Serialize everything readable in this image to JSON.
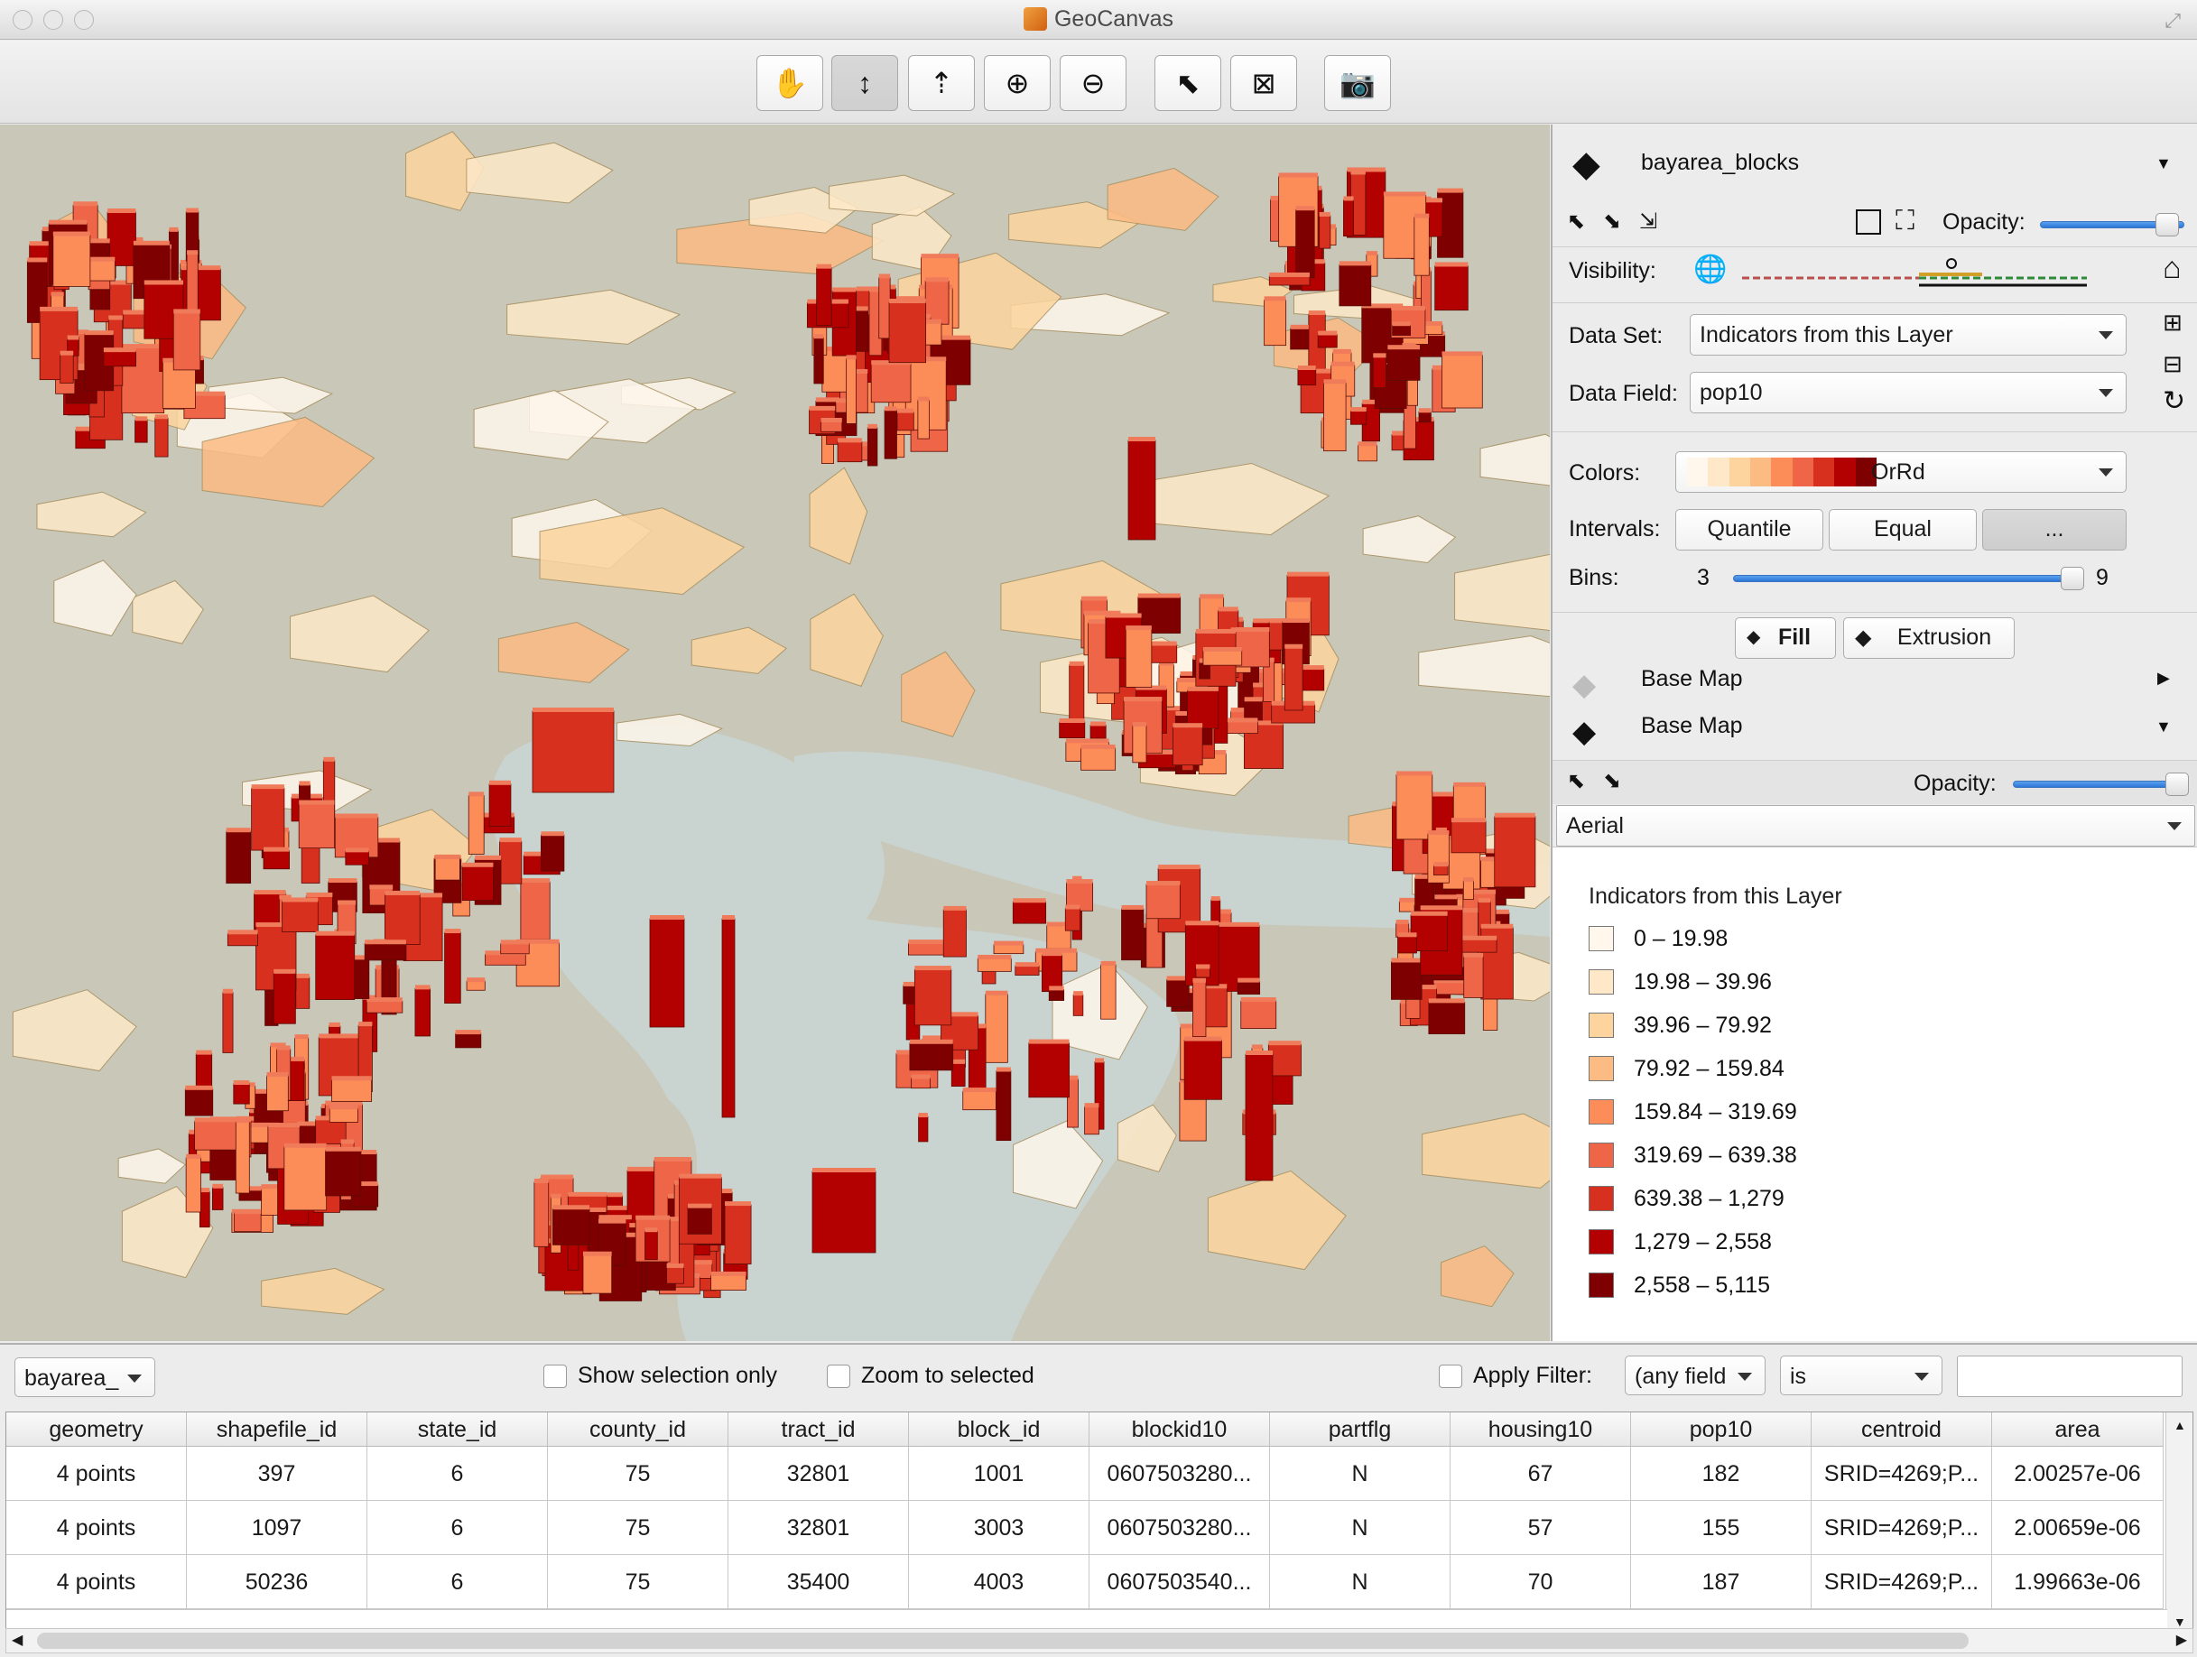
{
  "window": {
    "title": "GeoCanvas"
  },
  "toolbar": {
    "buttons": [
      {
        "icon": "hand-pan-icon",
        "glyph": "✋"
      },
      {
        "icon": "vertical-tilt-icon",
        "glyph": "↕"
      },
      {
        "icon": "rotate-view-icon",
        "glyph": "⇡"
      },
      {
        "icon": "zoom-in-icon",
        "glyph": "⊕"
      },
      {
        "icon": "zoom-out-icon",
        "glyph": "⊖"
      },
      {
        "icon": "select-arrow-icon",
        "glyph": "⬉"
      },
      {
        "icon": "clear-selection-icon",
        "glyph": "⊠"
      },
      {
        "icon": "camera-icon",
        "glyph": "📷"
      }
    ],
    "active_button": "vertical-tilt-icon"
  },
  "panel": {
    "layer_name": "bayarea_blocks",
    "opacity_label": "Opacity:",
    "visibility_label": "Visibility:",
    "dataset_label": "Data Set:",
    "dataset_value": "Indicators from this Layer",
    "datafield_label": "Data Field:",
    "datafield_value": "pop10",
    "colors_label": "Colors:",
    "colors_value": "OrRd",
    "intervals_label": "Intervals:",
    "interval_buttons": [
      "Quantile",
      "Equal",
      "..."
    ],
    "bins_label": "Bins:",
    "bins_min": "3",
    "bins_max": "9",
    "tabs": [
      "Fill",
      "Extrusion"
    ],
    "base_map_1": "Base Map",
    "base_map_2": "Base Map",
    "base_opacity_label": "Opacity:",
    "basemap_select": "Aerial",
    "layer_opacity": 0.88,
    "base_opacity": 0.96,
    "bins_value": 9
  },
  "legend": {
    "title": "Indicators from this Layer",
    "items": [
      {
        "label": "0 – 19.98",
        "color": "#fff7ec"
      },
      {
        "label": "19.98 – 39.96",
        "color": "#fee8c8"
      },
      {
        "label": "39.96 – 79.92",
        "color": "#fdd49e"
      },
      {
        "label": "79.92 – 159.84",
        "color": "#fdbb84"
      },
      {
        "label": "159.84 – 319.69",
        "color": "#fc8d59"
      },
      {
        "label": "319.69 – 639.38",
        "color": "#ef6548"
      },
      {
        "label": "639.38 – 1,279",
        "color": "#d7301f"
      },
      {
        "label": "1,279 – 2,558",
        "color": "#b30000"
      },
      {
        "label": "2,558 – 5,115",
        "color": "#7f0000"
      }
    ]
  },
  "table_controls": {
    "layer_select": "bayarea_",
    "show_selection_only": "Show selection only",
    "zoom_to_selected": "Zoom to selected",
    "apply_filter": "Apply Filter:",
    "filter_field": "(any field",
    "filter_op": "is",
    "filter_value": ""
  },
  "table": {
    "columns": [
      "geometry",
      "shapefile_id",
      "state_id",
      "county_id",
      "tract_id",
      "block_id",
      "blockid10",
      "partflg",
      "housing10",
      "pop10",
      "centroid",
      "area"
    ],
    "rows": [
      [
        "4 points",
        "397",
        "6",
        "75",
        "32801",
        "1001",
        "0607503280...",
        "N",
        "67",
        "182",
        "SRID=4269;P...",
        "2.00257e-06"
      ],
      [
        "4 points",
        "1097",
        "6",
        "75",
        "32801",
        "3003",
        "0607503280...",
        "N",
        "57",
        "155",
        "SRID=4269;P...",
        "2.00659e-06"
      ],
      [
        "4 points",
        "50236",
        "6",
        "75",
        "35400",
        "4003",
        "0607503540...",
        "N",
        "70",
        "187",
        "SRID=4269;P...",
        "1.99663e-06"
      ]
    ]
  },
  "colors": {
    "water": "#c9d3cf",
    "land": "#c8c7b8",
    "accent_blue": "#3a7bd5"
  }
}
